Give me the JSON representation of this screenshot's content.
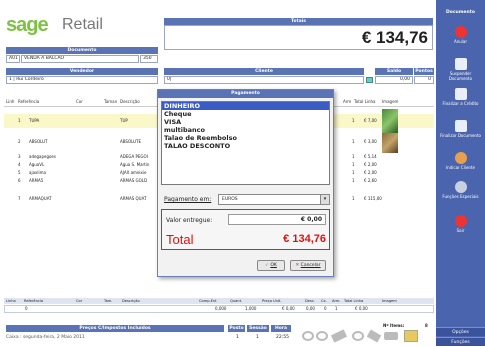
{
  "brand": {
    "logo": "sage",
    "product": "Retail"
  },
  "total_section": {
    "label": "Totais",
    "amount": "€ 134,76"
  },
  "documento": {
    "header": "Documento",
    "code": "A01",
    "doc_type": "VENDA A BALCAO",
    "number": "350"
  },
  "vendedor": {
    "header": "Vendedor",
    "value": "1 | Rui Cordeiro"
  },
  "cliente": {
    "header": "Cliente",
    "value": "0|",
    "saldo_header": "Saldo",
    "pontos_header": "Pontos",
    "saldo": "0,00",
    "pontos": "0"
  },
  "table_top": {
    "headers": [
      "Linh",
      "Referência",
      "Cor",
      "Taman",
      "Descrição",
      "Arm",
      "Total Linha",
      "Imagem"
    ],
    "rows": [
      {
        "linh": "1",
        "ref": "TUPA",
        "desc": "TUP",
        "arm": "1",
        "total": "€ 7,00"
      },
      {
        "linh": "2",
        "ref": "ABSOLUT",
        "desc": "ABSOLUTE",
        "arm": "1",
        "total": "€ 3,00"
      },
      {
        "linh": "3",
        "ref": "adegapegoes",
        "desc": "ADEGA PEGOI",
        "arm": "1",
        "total": "€ 5,14"
      },
      {
        "linh": "4",
        "ref": "AguaVL",
        "desc": "Agua S. Martin",
        "arm": "1",
        "total": "€ 2,00"
      },
      {
        "linh": "5",
        "ref": "ajaxlima",
        "desc": "AJAX ameixie",
        "arm": "1",
        "total": "€ 2,00"
      },
      {
        "linh": "6",
        "ref": "ARMA5",
        "desc": "ARMAS GOLD",
        "arm": "1",
        "total": "€ 2,60"
      },
      {
        "linh": "7",
        "ref": "ARMAQUAT",
        "desc": "ARMAS QUAT",
        "arm": "1",
        "total": "€ 115,00"
      }
    ]
  },
  "payment_dialog": {
    "title": "Pagamento",
    "methods": [
      "DINHEIRO",
      "Cheque",
      "VISA",
      "multibanco",
      "Talao de Reembolso",
      "TALAO DESCONTO"
    ],
    "selected": "DINHEIRO",
    "payment_in_label": "Pagamento em:",
    "currency": "EUROS",
    "delivered_label": "Valor entregue:",
    "delivered_value": "€ 0,00",
    "total_label": "Total",
    "total_value": "€ 134,76",
    "ok": "OK",
    "cancel": "Cancelar"
  },
  "table_bottom": {
    "headers": [
      "Linha",
      "Referência",
      "Cor",
      "Tam.",
      "Descrição",
      "Comp.Ent",
      "Quant.",
      "Preço Unit.",
      "Desc.",
      "Cx.",
      "Arm.",
      "Total Linha",
      "Imagem"
    ],
    "row": {
      "linha": "0",
      "comp": "0,000",
      "quant": "1,000",
      "preco": "€ 0,00",
      "desc": "0,00",
      "cx": "0",
      "arm": "1",
      "total": "€ 0,00"
    }
  },
  "footer": {
    "precos_header": "Preços C/Impostos Incluídos",
    "posto_header": "Posto",
    "sessao_header": "Sessão",
    "hora_header": "Hora",
    "status": "Caixa : segunda-feira, 2 Maio 2011",
    "posto": "1",
    "sessao": "1",
    "hora": "22:55",
    "items_label": "Nº Items:",
    "items": "8"
  },
  "sidebar": {
    "title": "Documento",
    "buttons": [
      "Anular",
      "Suspender Documento",
      "Finalizar a Crédito",
      "Finalizar Documento",
      "Indicar Cliente",
      "Funções Especiais",
      "Sair"
    ],
    "options": "Opções",
    "functions": "Funções"
  },
  "colors": {
    "accent": "#4a64ad",
    "total_red": "#e01010",
    "selected_row": "#faf7c8"
  }
}
